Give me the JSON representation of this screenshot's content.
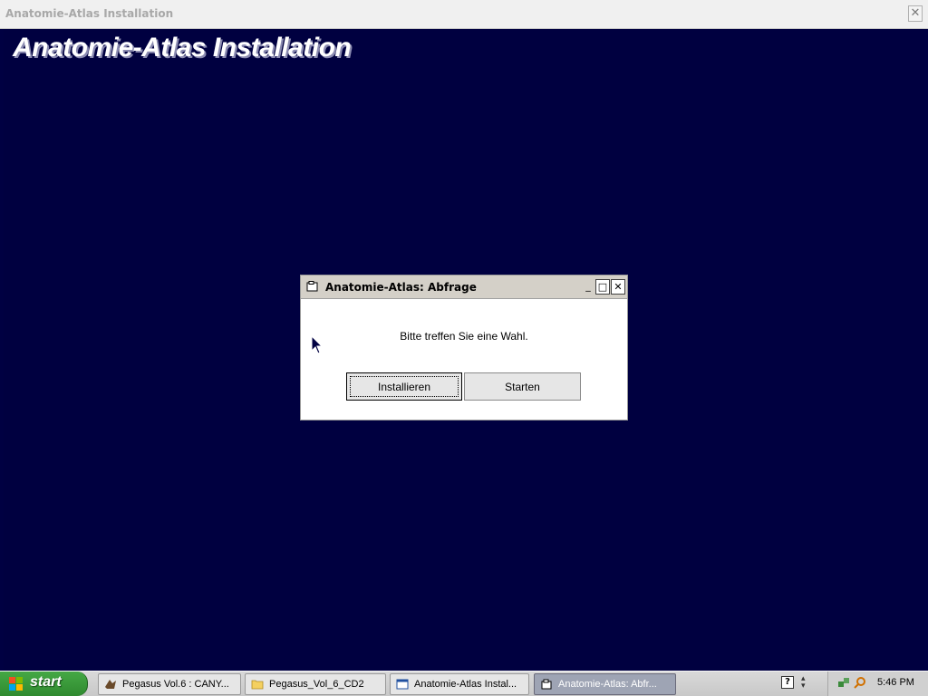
{
  "main_window": {
    "title": "Anatomie-Atlas Installation",
    "banner": "Anatomie-Atlas Installation",
    "close_symbol": "✕"
  },
  "dialog": {
    "title": "Anatomie-Atlas: Abfrage",
    "message": "Bitte treffen Sie eine Wahl.",
    "install_button": "Installieren",
    "start_button": "Starten",
    "min_symbol": "_",
    "max_symbol": "□",
    "close_symbol": "✕"
  },
  "taskbar": {
    "start_label": "start",
    "tasks": [
      {
        "label": "Pegasus Vol.6 : CANY...",
        "icon": "game-icon"
      },
      {
        "label": "Pegasus_Vol_6_CD2",
        "icon": "folder-icon"
      },
      {
        "label": "Anatomie-Atlas Instal...",
        "icon": "window-icon"
      },
      {
        "label": "Anatomie-Atlas: Abfr...",
        "icon": "app-icon",
        "active": true
      }
    ],
    "help_symbol": "?",
    "clock": "5:46 PM"
  },
  "colors": {
    "desktop_bg": "#000042",
    "start_green": "#3a9a3a",
    "active_task": "#9ea4b4"
  }
}
